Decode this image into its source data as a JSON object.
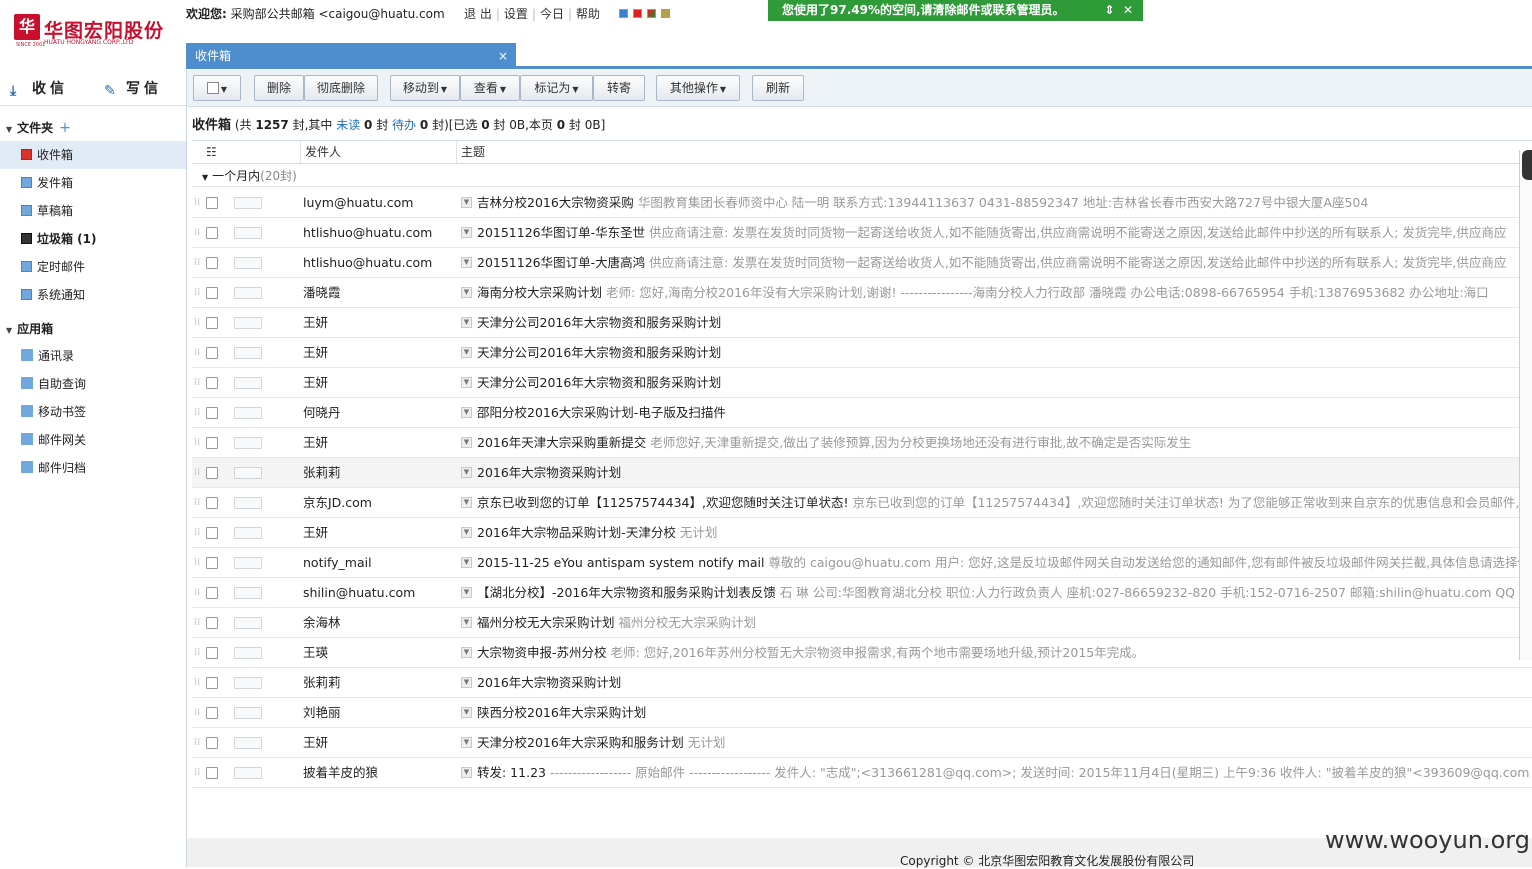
{
  "header": {
    "logo_text": "华图宏阳股份",
    "logo_en": "HUATU HONGYANG CORP.,LTD",
    "logo_since": "SINCE 2001",
    "welcome_label": "欢迎您:",
    "welcome_user": "采购部公共邮箱 <caigou@huatu.com",
    "links": [
      "退 出",
      "设置",
      "今日",
      "帮助"
    ],
    "quota_notice": "您使用了97.49%的空间,请清除邮件或联系管理员。"
  },
  "tab": {
    "label": "收件箱",
    "close": "×"
  },
  "sidebar": {
    "receive_label": "收信",
    "compose_label": "写信",
    "folders_title": "文件夹",
    "folders": [
      {
        "label": "收件箱"
      },
      {
        "label": "发件箱"
      },
      {
        "label": "草稿箱"
      },
      {
        "label": "垃圾箱 (1)"
      },
      {
        "label": "定时邮件"
      },
      {
        "label": "系统通知"
      }
    ],
    "apps_title": "应用箱",
    "apps": [
      {
        "label": "通讯录"
      },
      {
        "label": "自助查询"
      },
      {
        "label": "移动书签"
      },
      {
        "label": "邮件网关"
      },
      {
        "label": "邮件归档"
      }
    ]
  },
  "toolbar": {
    "delete": "删除",
    "purge": "彻底删除",
    "move_to": "移动到",
    "view": "查看",
    "mark_as": "标记为",
    "forward": "转寄",
    "more": "其他操作",
    "refresh": "刷新"
  },
  "summary": {
    "title": "收件箱",
    "p1": "(共 ",
    "total": "1257",
    "p2": " 封,其中 ",
    "unread_label": "未读",
    "unread": "0",
    "p3": " 封 ",
    "todo_label": "待办",
    "todo": "0",
    "p4": " 封)[已选 ",
    "selected": "0",
    "p5": " 封 0B,本页 ",
    "page_count": "0",
    "p6": " 封 0B]"
  },
  "columns": {
    "sender": "发件人",
    "subject": "主题"
  },
  "group": {
    "label": "一个月内",
    "count": "(20封)"
  },
  "messages": [
    {
      "sender": "luym@huatu.com",
      "subject": "吉林分校2016大宗物资采购",
      "preview": "华图教育集团长春师资中心 陆一明 联系方式:13944113637 0431-88592347 地址:吉林省长春市西安大路727号中银大厦A座504"
    },
    {
      "sender": "htlishuo@huatu.com",
      "subject": "20151126华图订单-华东圣世",
      "preview": "供应商请注意: 发票在发货时同货物一起寄送给收货人,如不能随货寄出,供应商需说明不能寄送之原因,发送给此邮件中抄送的所有联系人; 发货完毕,供应商应"
    },
    {
      "sender": "htlishuo@huatu.com",
      "subject": "20151126华图订单-大唐高鸿",
      "preview": "供应商请注意: 发票在发货时同货物一起寄送给收货人,如不能随货寄出,供应商需说明不能寄送之原因,发送给此邮件中抄送的所有联系人; 发货完毕,供应商应"
    },
    {
      "sender": "潘晓霞",
      "subject": "海南分校大宗采购计划",
      "preview": "老师: 您好,海南分校2016年没有大宗采购计划,谢谢! ----------------海南分校人力行政部 潘晓霞 办公电话:0898-66765954 手机:13876953682 办公地址:海口"
    },
    {
      "sender": "王妍",
      "subject": "天津分公司2016年大宗物资和服务采购计划",
      "preview": ""
    },
    {
      "sender": "王妍",
      "subject": "天津分公司2016年大宗物资和服务采购计划",
      "preview": ""
    },
    {
      "sender": "王妍",
      "subject": "天津分公司2016年大宗物资和服务采购计划",
      "preview": ""
    },
    {
      "sender": "何晓丹",
      "subject": "邵阳分校2016大宗采购计划-电子版及扫描件",
      "preview": ""
    },
    {
      "sender": "王妍",
      "subject": "2016年天津大宗采购重新提交",
      "preview": "老师您好,天津重新提交,做出了装修预算,因为分校更换场地还没有进行审批,故不确定是否实际发生"
    },
    {
      "sender": "张莉莉",
      "subject": "2016年大宗物资采购计划",
      "preview": ""
    },
    {
      "sender": "京东JD.com",
      "subject": "京东已收到您的订单【11257574434】,欢迎您随时关注订单状态!",
      "preview": "京东已收到您的订单【11257574434】,欢迎您随时关注订单状态! 为了您能够正常收到来自京东的优惠信息和会员邮件,"
    },
    {
      "sender": "王妍",
      "subject": "2016年大宗物品采购计划-天津分校",
      "preview": "无计划"
    },
    {
      "sender": "notify_mail",
      "subject": "2015-11-25 eYou antispam system notify mail",
      "preview": "尊敬的 caigou@huatu.com 用户: 您好,这是反垃圾邮件网关自动发送给您的通知邮件,您有邮件被反垃圾邮件网关拦截,具体信息请选择使"
    },
    {
      "sender": "shilin@huatu.com",
      "subject": "【湖北分校】-2016年大宗物资和服务采购计划表反馈",
      "preview": "石 琳 公司:华图教育湖北分校 职位:人力行政负责人 座机:027-86659232-820 手机:152-0716-2507 邮箱:shilin@huatu.com QQ"
    },
    {
      "sender": "余海林",
      "subject": "福州分校无大宗采购计划",
      "preview": "福州分校无大宗采购计划"
    },
    {
      "sender": "王瑛",
      "subject": "大宗物资申报-苏州分校",
      "preview": "老师: 您好,2016年苏州分校暂无大宗物资申报需求,有两个地市需要场地升级,预计2015年完成。"
    },
    {
      "sender": "张莉莉",
      "subject": "2016年大宗物资采购计划",
      "preview": ""
    },
    {
      "sender": "刘艳丽",
      "subject": "陕西分校2016年大宗采购计划",
      "preview": ""
    },
    {
      "sender": "王妍",
      "subject": "天津分校2016年大宗采购和服务计划",
      "preview": "无计划"
    },
    {
      "sender": "披着羊皮的狼",
      "subject": "转发: 11.23",
      "preview": "------------------ 原始邮件 ------------------ 发件人: \"志成\";<313661281@qq.com>; 发送时间: 2015年11月4日(星期三) 上午9:36 收件人: \"披着羊皮的狼\"<393609@qq.com"
    }
  ],
  "footer": {
    "copyright": "Copyright © 北京华图宏阳教育文化发展股份有限公司"
  },
  "watermark": "www.wooyun.org",
  "colors": {
    "accent": "#4e8ecf",
    "quota_bg": "#2e9a38",
    "logo_red": "#c8102e"
  }
}
